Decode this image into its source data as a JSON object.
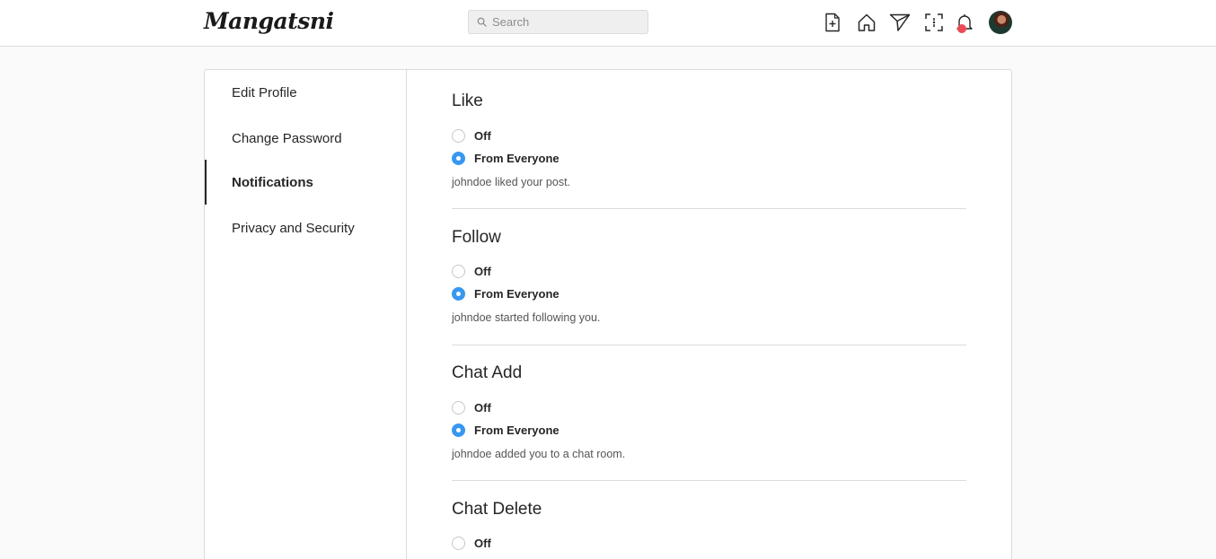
{
  "app": {
    "logo": "Mangatsni"
  },
  "search": {
    "placeholder": "Search"
  },
  "nav": {
    "icons": [
      "new-post-icon",
      "home-icon",
      "direct-icon",
      "explore-icon",
      "notifications-icon"
    ],
    "notification_dot_color": "#ed4956"
  },
  "sidebar": {
    "items": [
      {
        "label": "Edit Profile",
        "active": false
      },
      {
        "label": "Change Password",
        "active": false
      },
      {
        "label": "Notifications",
        "active": true
      },
      {
        "label": "Privacy and Security",
        "active": false
      }
    ]
  },
  "settings": {
    "sections": [
      {
        "title": "Like",
        "options": [
          "Off",
          "From Everyone"
        ],
        "selected": "From Everyone",
        "example": "johndoe liked your post."
      },
      {
        "title": "Follow",
        "options": [
          "Off",
          "From Everyone"
        ],
        "selected": "From Everyone",
        "example": "johndoe started following you."
      },
      {
        "title": "Chat Add",
        "options": [
          "Off",
          "From Everyone"
        ],
        "selected": "From Everyone",
        "example": "johndoe added you to a chat room."
      },
      {
        "title": "Chat Delete",
        "options": [
          "Off"
        ],
        "selected": "",
        "example": ""
      }
    ]
  },
  "colors": {
    "accent": "#3897f0",
    "border": "#dbdbdb",
    "background": "#fafafa"
  }
}
